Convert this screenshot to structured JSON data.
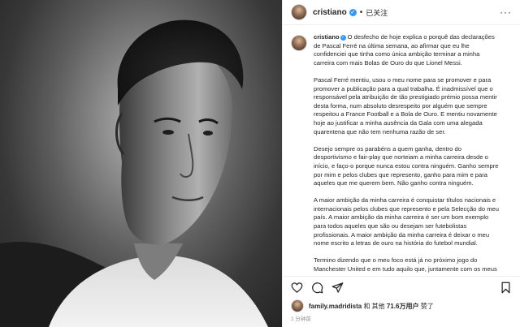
{
  "header": {
    "username": "cristiano",
    "follow_label": "已关注",
    "more_label": "···"
  },
  "caption": {
    "author": "cristiano",
    "paragraphs": [
      "O desfecho de hoje explica o porquê das declarações de Pascal Ferré na última semana, ao afirmar que eu lhe confidenciei que tinha como única ambição terminar a minha carreira com mais Bolas de Ouro do que Lionel Messi.",
      "Pascal Ferré mentiu, usou o meu nome para se promover e para promover a publicação para a qual trabalha. É inadmissível que o responsável pela atribuição de tão prestigiado prémio possa mentir desta forma, num absoluto desrespeito por alguém que sempre respeitou a France Football e a Bola de Ouro. E mentiu novamente hoje ao justificar a minha ausência da Gala com uma alegada quarentena que não tem nenhuma razão de ser.",
      "Desejo sempre os parabéns a quem ganha, dentro do desportivismo e fair-play que norteiam a minha carreira desde o início, e faço-o porque nunca estou contra ninguém. Ganho sempre por mim e pelos clubes que represento, ganho para mim e para aqueles que me querem bem. Não ganho contra ninguém.",
      "A maior ambição da minha carreira é conquistar títulos nacionais e internacionais pelos clubes que represento e pela Selecção do meu país. A maior ambição da minha carreira é ser um bom exemplo para todos aqueles que são ou desejam ser futebolistas profissionais. A maior ambição da minha carreira é deixar o meu nome escrito a letras de ouro na história do futebol mundial.",
      "Termino dizendo que o meu foco está já no próximo jogo do Manchester United e em tudo aquilo que, juntamente com os meus"
    ]
  },
  "actions": {
    "like_icon": "heart-icon",
    "comment_icon": "comment-icon",
    "share_icon": "share-icon",
    "save_icon": "bookmark-icon"
  },
  "likes": {
    "first_liker": "family.madridista",
    "middle_text": " 和 其他 ",
    "count": "71.6万用户",
    "suffix": " 赞了"
  },
  "timestamp": "1 分钟前",
  "colors": {
    "verified": "#3897f0",
    "text": "#262626",
    "muted": "#8e8e8e",
    "border": "#efefef"
  }
}
